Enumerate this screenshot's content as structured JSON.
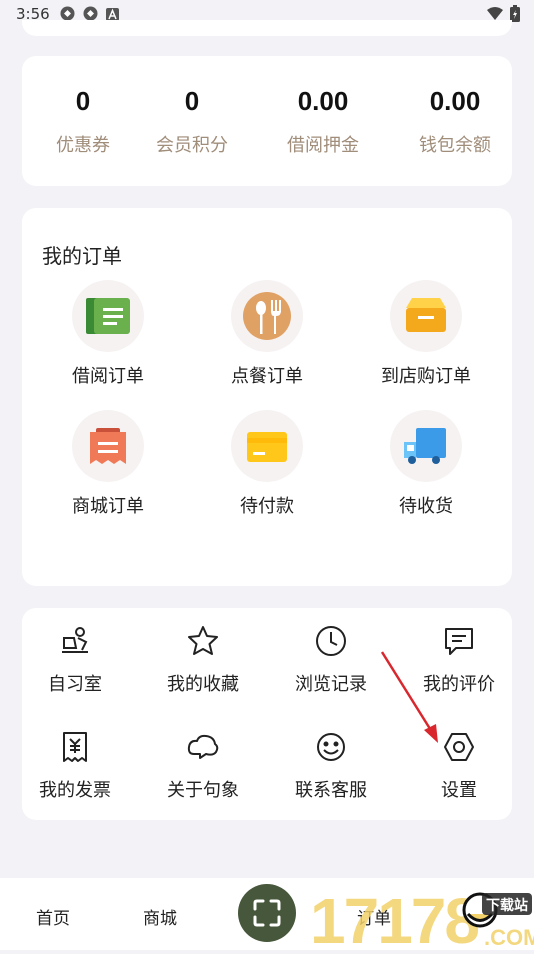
{
  "status_bar": {
    "time": "3:56"
  },
  "stats": [
    {
      "value": "0",
      "label": "优惠券"
    },
    {
      "value": "0",
      "label": "会员积分"
    },
    {
      "value": "0.00",
      "label": "借阅押金"
    },
    {
      "value": "0.00",
      "label": "钱包余额"
    }
  ],
  "orders": {
    "title": "我的订单",
    "items": [
      {
        "label": "借阅订单",
        "icon": "book-icon"
      },
      {
        "label": "点餐订单",
        "icon": "fork-spoon-icon"
      },
      {
        "label": "到店购订单",
        "icon": "box-icon"
      },
      {
        "label": "商城订单",
        "icon": "receipt-icon"
      },
      {
        "label": "待付款",
        "icon": "card-icon"
      },
      {
        "label": "待收货",
        "icon": "truck-icon"
      }
    ]
  },
  "tools": [
    {
      "label": "自习室",
      "icon": "desk-icon"
    },
    {
      "label": "我的收藏",
      "icon": "star-icon"
    },
    {
      "label": "浏览记录",
      "icon": "clock-icon"
    },
    {
      "label": "我的评价",
      "icon": "comment-icon"
    },
    {
      "label": "我的发票",
      "icon": "invoice-icon"
    },
    {
      "label": "关于句象",
      "icon": "cloud-icon"
    },
    {
      "label": "联系客服",
      "icon": "smile-icon"
    },
    {
      "label": "设置",
      "icon": "hexagon-settings-icon"
    }
  ],
  "bottom_nav": [
    {
      "label": "首页"
    },
    {
      "label": "商城"
    },
    {
      "label": "订单"
    }
  ],
  "watermark": {
    "text": "17178",
    "tag": "下载站",
    "domain": ".COM"
  },
  "colors": {
    "label_brown": "#a08d7a",
    "scan_green": "#47573b",
    "arrow_red": "#d9272e"
  }
}
